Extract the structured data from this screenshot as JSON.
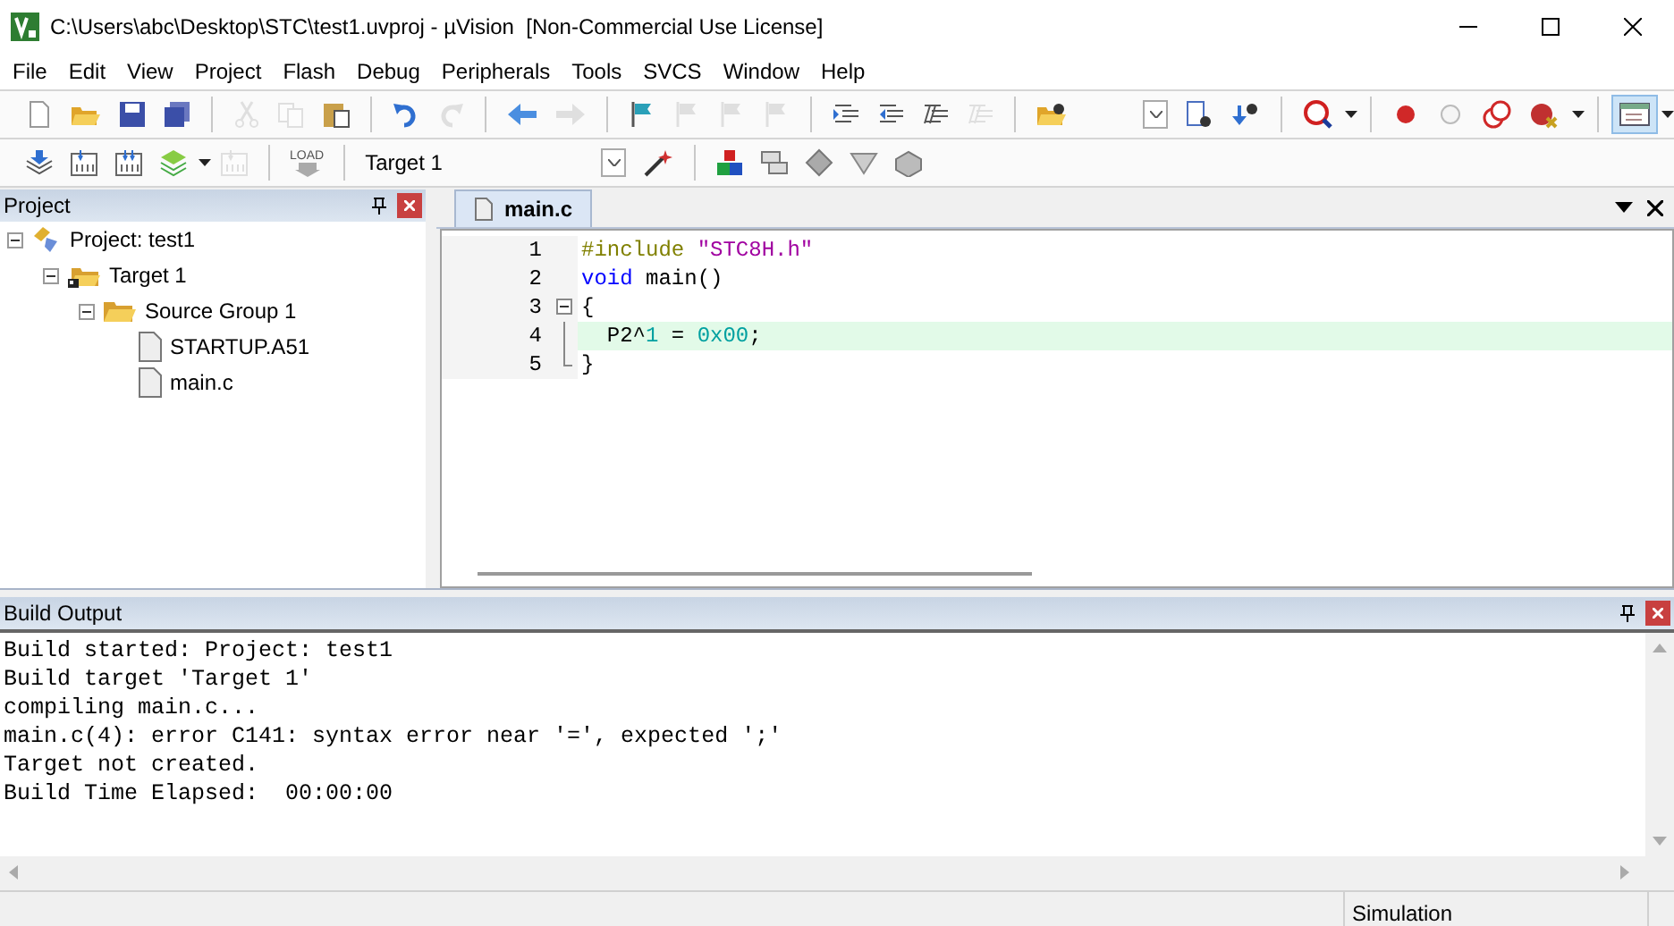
{
  "window": {
    "title": "C:\\Users\\abc\\Desktop\\STC\\test1.uvproj - µVision  [Non-Commercial Use License]"
  },
  "menu": [
    "File",
    "Edit",
    "View",
    "Project",
    "Flash",
    "Debug",
    "Peripherals",
    "Tools",
    "SVCS",
    "Window",
    "Help"
  ],
  "toolbar_1": [
    {
      "kind": "button",
      "disabled": false,
      "pressed": false
    },
    {
      "kind": "button",
      "disabled": false,
      "pressed": false
    },
    {
      "kind": "button",
      "disabled": false,
      "pressed": false
    },
    {
      "kind": "button",
      "disabled": false,
      "pressed": false
    },
    {
      "kind": "separator"
    },
    {
      "kind": "button",
      "disabled": true,
      "pressed": false
    },
    {
      "kind": "button",
      "disabled": true,
      "pressed": false
    },
    {
      "kind": "button",
      "disabled": false,
      "pressed": false
    },
    {
      "kind": "separator"
    },
    {
      "kind": "button",
      "disabled": false,
      "pressed": false
    },
    {
      "kind": "button",
      "disabled": true,
      "pressed": false
    },
    {
      "kind": "separator"
    },
    {
      "kind": "button",
      "disabled": false,
      "pressed": false
    },
    {
      "kind": "button",
      "disabled": true,
      "pressed": false
    },
    {
      "kind": "separator"
    },
    {
      "kind": "button",
      "disabled": false,
      "pressed": false
    },
    {
      "kind": "button",
      "disabled": true,
      "pressed": false
    },
    {
      "kind": "button",
      "disabled": true,
      "pressed": false
    },
    {
      "kind": "button",
      "disabled": true,
      "pressed": false
    },
    {
      "kind": "separator"
    },
    {
      "kind": "button",
      "disabled": false,
      "pressed": false
    },
    {
      "kind": "button",
      "disabled": false,
      "pressed": false
    },
    {
      "kind": "button",
      "disabled": false,
      "pressed": false
    },
    {
      "kind": "button",
      "disabled": true,
      "pressed": false
    },
    {
      "kind": "separator"
    },
    {
      "kind": "button",
      "disabled": false,
      "pressed": false
    },
    {
      "kind": "spacer"
    },
    {
      "kind": "combo"
    },
    {
      "kind": "button",
      "disabled": false,
      "pressed": false
    },
    {
      "kind": "button",
      "disabled": false,
      "pressed": false
    },
    {
      "kind": "separator"
    },
    {
      "kind": "button",
      "disabled": false,
      "pressed": false
    },
    {
      "kind": "separator"
    },
    {
      "kind": "button",
      "disabled": false,
      "pressed": false
    },
    {
      "kind": "button",
      "disabled": false,
      "pressed": false
    },
    {
      "kind": "button",
      "disabled": false,
      "pressed": false
    },
    {
      "kind": "button",
      "disabled": false,
      "pressed": false
    },
    {
      "kind": "separator"
    },
    {
      "kind": "button",
      "disabled": false,
      "pressed": true
    }
  ],
  "toolbar_2": [
    {
      "kind": "button",
      "disabled": false,
      "pressed": false
    },
    {
      "kind": "button",
      "disabled": false,
      "pressed": false
    },
    {
      "kind": "button",
      "disabled": false,
      "pressed": false
    },
    {
      "kind": "button",
      "disabled": false,
      "pressed": false
    },
    {
      "kind": "button",
      "disabled": true,
      "pressed": false
    },
    {
      "kind": "separator"
    },
    {
      "kind": "label_button",
      "label": "LOAD",
      "disabled": true,
      "pressed": false
    },
    {
      "kind": "separator"
    },
    {
      "kind": "select",
      "value": "Target 1"
    },
    {
      "kind": "button",
      "disabled": false,
      "pressed": false
    },
    {
      "kind": "separator"
    },
    {
      "kind": "button",
      "disabled": false,
      "pressed": false
    },
    {
      "kind": "button",
      "disabled": false,
      "pressed": false
    },
    {
      "kind": "button",
      "disabled": false,
      "pressed": false
    },
    {
      "kind": "button",
      "disabled": false,
      "pressed": false
    },
    {
      "kind": "button",
      "disabled": false,
      "pressed": false
    }
  ],
  "project_panel": {
    "title": "Project",
    "tree": [
      {
        "label": "Project: test1",
        "kind": "project",
        "expanded": true,
        "children": [
          {
            "label": "Target 1",
            "kind": "target",
            "expanded": true,
            "children": [
              {
                "label": "Source Group 1",
                "kind": "group",
                "expanded": true,
                "children": [
                  {
                    "label": "STARTUP.A51",
                    "kind": "file"
                  },
                  {
                    "label": "main.c",
                    "kind": "file"
                  }
                ]
              }
            ]
          }
        ]
      }
    ]
  },
  "editor": {
    "tabs": [
      {
        "label": "main.c",
        "selected": true
      }
    ],
    "lines": [
      {
        "number": "1",
        "highlighted": false,
        "kind": "plain",
        "tokens": [
          {
            "text": "#include ",
            "kind": "preprocessor"
          },
          {
            "text": "\"STC8H.h\"",
            "kind": "string"
          }
        ]
      },
      {
        "number": "2",
        "highlighted": false,
        "kind": "plain",
        "tokens": [
          {
            "text": "void",
            "kind": "keyword"
          },
          {
            "text": " main()",
            "kind": "plain"
          }
        ]
      },
      {
        "number": "3",
        "highlighted": false,
        "kind": "fold_start",
        "tokens": [
          {
            "text": "{",
            "kind": "plain"
          }
        ]
      },
      {
        "number": "4",
        "highlighted": true,
        "kind": "fold_body",
        "tokens": [
          {
            "text": "  P2^",
            "kind": "plain"
          },
          {
            "text": "1",
            "kind": "number"
          },
          {
            "text": " = ",
            "kind": "plain"
          },
          {
            "text": "0x00",
            "kind": "number"
          },
          {
            "text": ";",
            "kind": "plain"
          }
        ]
      },
      {
        "number": "5",
        "highlighted": false,
        "kind": "fold_end",
        "tokens": [
          {
            "text": "}",
            "kind": "plain"
          }
        ]
      }
    ]
  },
  "build_output": {
    "title": "Build Output",
    "lines": [
      "Build started: Project: test1",
      "Build target 'Target 1'",
      "compiling main.c...",
      "main.c(4): error C141: syntax error near '=', expected ';'",
      "Target not created.",
      "Build Time Elapsed:  00:00:00"
    ]
  },
  "status_bar": {
    "mode": "Simulation"
  }
}
